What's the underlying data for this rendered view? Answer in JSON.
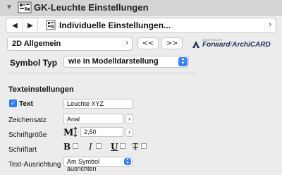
{
  "title_bar": {
    "title": "GK-Leuchte Einstellungen"
  },
  "nav": {
    "label": "Individuelle Einstellungen..."
  },
  "page_selector": {
    "selected": "2D Allgemein",
    "prev_label": "<<",
    "next_label": ">>"
  },
  "logo": {
    "top_text": "GRAPHISOFT",
    "brand": "Forward",
    "product": "ArchiCARD"
  },
  "symbol_type": {
    "label": "Symbol Typ",
    "selected": "wie in Modelldarstellung"
  },
  "text_settings": {
    "section_title": "Texteinstellungen",
    "text_enabled": true,
    "text_label": "Text",
    "text_value": "Leuchte XYZ",
    "font_label": "Zeichensatz",
    "font_value": "Arial",
    "size_label": "Schriftgröße",
    "size_value": "2,50",
    "style_label": "Schriftart",
    "bold_glyph": "B",
    "italic_glyph": "I",
    "underline_glyph": "U",
    "strike_glyph": "T",
    "align_label": "Text-Ausrichtung",
    "align_value": "Am Symbol ausrichten"
  },
  "colors": {
    "accent": "#3b82f6",
    "logo_blue": "#1f3157"
  }
}
